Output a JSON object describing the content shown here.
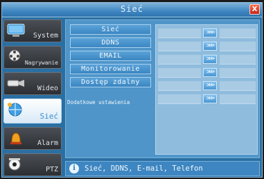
{
  "window": {
    "title": "Sieć",
    "close_label": "X"
  },
  "sidebar": {
    "items": [
      {
        "label": "System",
        "icon": "monitor-icon"
      },
      {
        "label": "Nagrywanie",
        "icon": "film-reel-icon"
      },
      {
        "label": "Wideo",
        "icon": "camera-icon"
      },
      {
        "label": "Sieć",
        "icon": "network-icon",
        "active": true
      },
      {
        "label": "Alarm",
        "icon": "alarm-bell-icon"
      },
      {
        "label": "PTZ",
        "icon": "ptz-camera-icon"
      }
    ]
  },
  "menu": {
    "items": [
      "Sieć",
      "DDNS",
      "EMAIL",
      "Monitorowanie",
      "Dostęp zdalny"
    ],
    "extra": "Dodatkowe ustawienia",
    "arrow": ">>>"
  },
  "status": {
    "text": "Sieć, DDNS, E-mail, Telefon",
    "icon": "info-icon"
  },
  "colors": {
    "accent": "#3d8fd0",
    "panel": "#4f95c9",
    "sidebar_dark": "#2c2f33"
  }
}
